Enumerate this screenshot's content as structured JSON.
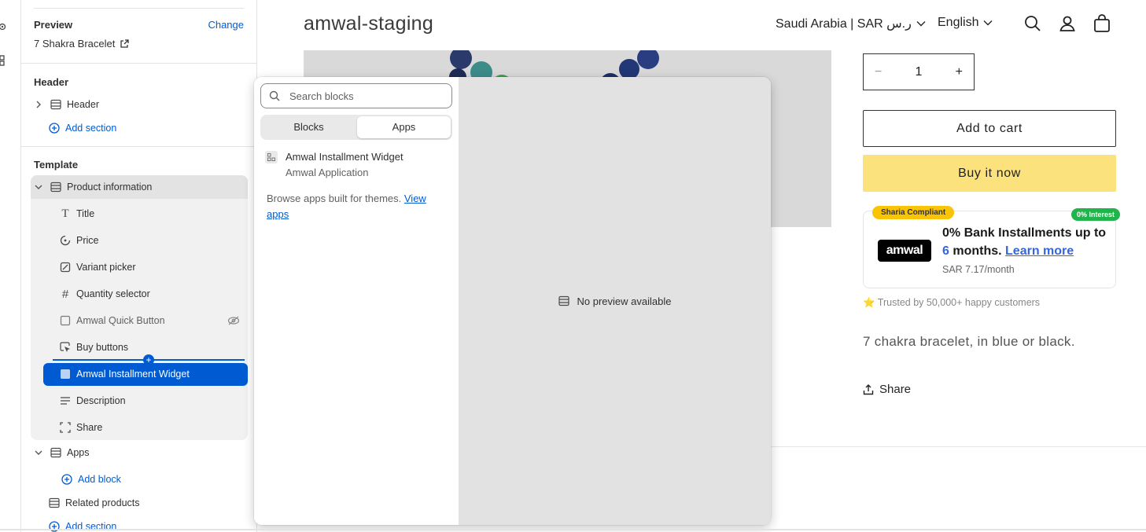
{
  "sidebar": {
    "preview": {
      "label": "Preview",
      "change": "Change",
      "product": "7 Shakra Bracelet"
    },
    "header_section": {
      "heading": "Header",
      "item": "Header",
      "add_section": "Add section"
    },
    "template": {
      "heading": "Template",
      "group": "Product information",
      "blocks": [
        {
          "label": "Title",
          "icon": "text-icon"
        },
        {
          "label": "Price",
          "icon": "price-tag-icon"
        },
        {
          "label": "Variant picker",
          "icon": "variant-icon"
        },
        {
          "label": "Quantity selector",
          "icon": "hash-icon"
        },
        {
          "label": "Amwal Quick Button",
          "icon": "app-block-icon",
          "hidden": true
        },
        {
          "label": "Buy buttons",
          "icon": "cursor-click-icon"
        },
        {
          "label": "Amwal Installment Widget",
          "icon": "app-block-icon",
          "selected": true
        },
        {
          "label": "Description",
          "icon": "paragraph-icon"
        },
        {
          "label": "Share",
          "icon": "share-frame-icon"
        }
      ],
      "apps_group": "Apps",
      "add_block": "Add block",
      "related": "Related products",
      "add_section": "Add section"
    }
  },
  "popover": {
    "search_placeholder": "Search blocks",
    "tabs": [
      {
        "label": "Blocks",
        "active": false
      },
      {
        "label": "Apps",
        "active": true
      }
    ],
    "app_item": {
      "name": "Amwal Installment Widget",
      "source": "Amwal Application"
    },
    "browse_text": "Browse apps built for themes.",
    "browse_link": "View apps",
    "no_preview": "No preview available"
  },
  "store": {
    "title": "amwal-staging",
    "country": "Saudi Arabia | SAR ر.س",
    "language": "English",
    "quantity": "1",
    "add_to_cart": "Add to cart",
    "buy_now": "Buy it now",
    "widget": {
      "badge_left": "Sharia Compliant",
      "badge_right": "0% Interest",
      "logo": "amwal",
      "line_start": "0% Bank Installments up to",
      "months_num": "6",
      "months_word": "months.",
      "learn_more": "Learn more",
      "monthly": "SAR 7.17/month",
      "trusted": "⭐ Trusted by 50,000+ happy customers"
    },
    "description": "7 chakra bracelet, in blue or black.",
    "share": "Share"
  },
  "colors": {
    "accent": "#005bd3",
    "buy_button": "#fbe27c",
    "sharia_badge": "#f9c405",
    "interest_badge": "#22b44c"
  }
}
